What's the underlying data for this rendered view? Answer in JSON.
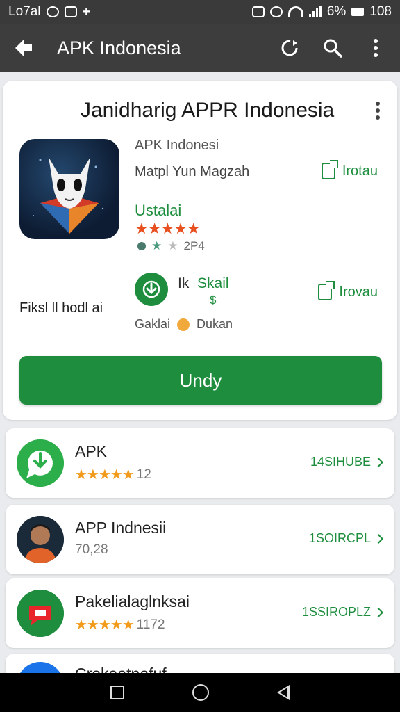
{
  "status_bar": {
    "carrier": "Lo7al",
    "battery_percent": "6%",
    "time": "108"
  },
  "app_bar": {
    "title": "APK Indonesia",
    "icons": [
      "back-arrow-icon",
      "refresh-icon",
      "search-icon",
      "more-vert-icon"
    ]
  },
  "app_card": {
    "title": "Janidharig APPR Indonesia",
    "developer": "APK Indonesi",
    "subtitle": "Matpl Yun Magzah",
    "side_link_1": "Irotau",
    "installs_label": "Ustalai",
    "stars": "★★★★★",
    "rating_count": "2P4",
    "left_label": "Fiksl ll hodl ai",
    "download_size": "Ik",
    "download_label": "Skail",
    "download_currency": "$",
    "side_link_2": "Irovau",
    "category_left": "Gaklai",
    "category_right": "Dukan",
    "install_button": "Undy"
  },
  "list_items": [
    {
      "name": "APK",
      "stars": "★★★★★",
      "meta": "12",
      "action": "14SIHUBE"
    },
    {
      "name": "APP Indnesii",
      "stars": "",
      "meta": "70,28",
      "action": "1SOIRCPL"
    },
    {
      "name": "Pakelialaglnksai",
      "stars": "★★★★★",
      "meta": "1172",
      "action": "1SSIROPLZ"
    },
    {
      "name": "Crekaatnafuf",
      "stars": "",
      "meta": "",
      "action": ""
    }
  ],
  "colors": {
    "accent_green": "#1e8e3e",
    "app_bar": "#3d3d3d",
    "star_orange": "#e8501f"
  }
}
